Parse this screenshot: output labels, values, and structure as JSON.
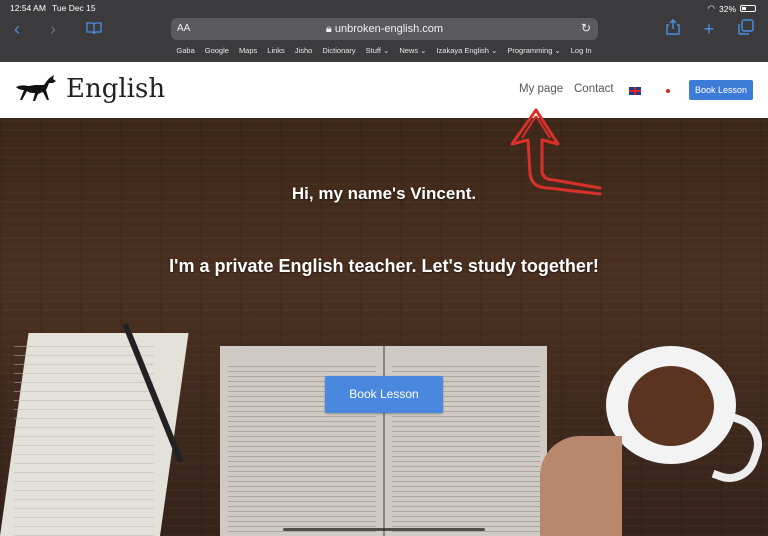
{
  "status_bar": {
    "time": "12:54 AM",
    "date": "Tue Dec 15",
    "battery": "32%"
  },
  "browser": {
    "text_size_label": "AA",
    "url": "unbroken-english.com",
    "bookmarks": [
      "Gaba",
      "Google",
      "Maps",
      "Links",
      "Jisho",
      "Dictionary",
      "Stuff ⌄",
      "News ⌄",
      "Izakaya English ⌄",
      "Programming ⌄",
      "Log In"
    ]
  },
  "header": {
    "brand": "English",
    "nav": {
      "my_page": "My page",
      "contact": "Contact"
    },
    "book_button": "Book Lesson"
  },
  "hero": {
    "greeting": "Hi, my name's Vincent.",
    "tagline": "I'm a private English teacher. Let's study together!",
    "book_button": "Book Lesson"
  },
  "colors": {
    "accent": "#4a88e0",
    "annotation": "#d8302a"
  }
}
